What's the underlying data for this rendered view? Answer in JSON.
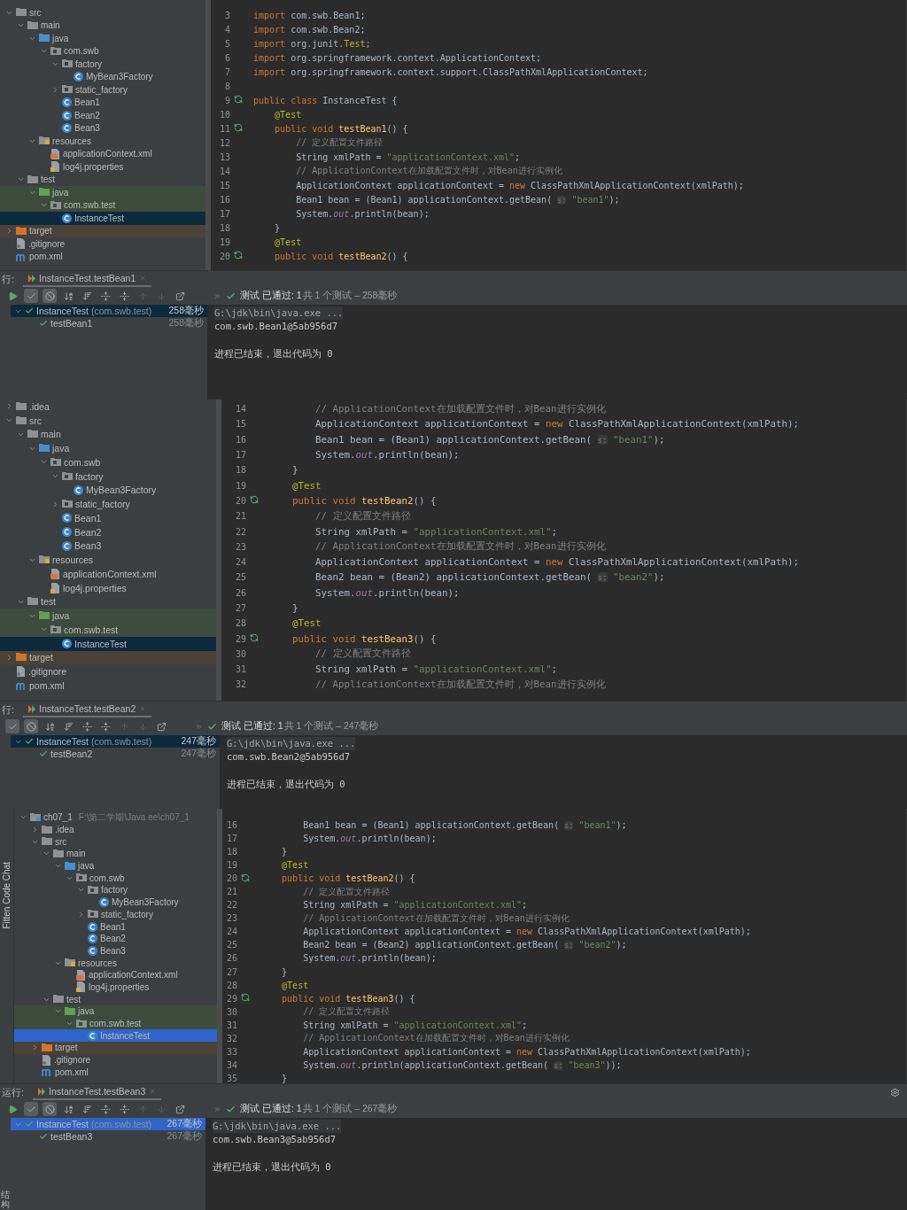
{
  "sections": [
    {
      "tree": [
        {
          "label": "src",
          "kind": "folder",
          "expanded": true,
          "selected": false,
          "children": [
            {
              "label": "main",
              "kind": "folder",
              "expanded": true,
              "selected": false,
              "children": [
                {
                  "label": "java",
                  "kind": "source",
                  "expanded": true,
                  "selected": false,
                  "children": [
                    {
                      "label": "com.swb",
                      "kind": "package",
                      "expanded": true,
                      "selected": false,
                      "children": [
                        {
                          "label": "factory",
                          "kind": "package",
                          "expanded": true,
                          "selected": false,
                          "children": [
                            {
                              "label": "MyBean3Factory",
                              "kind": "class",
                              "selected": false
                            }
                          ]
                        },
                        {
                          "label": "static_factory",
                          "kind": "package",
                          "expanded": false,
                          "selected": false
                        },
                        {
                          "label": "Bean1",
                          "kind": "class",
                          "selected": false
                        },
                        {
                          "label": "Bean2",
                          "kind": "class",
                          "selected": false
                        },
                        {
                          "label": "Bean3",
                          "kind": "class",
                          "selected": false
                        }
                      ]
                    }
                  ]
                },
                {
                  "label": "resources",
                  "kind": "resources",
                  "expanded": true,
                  "selected": false,
                  "children": [
                    {
                      "label": "applicationContext.xml",
                      "kind": "xml",
                      "selected": false
                    },
                    {
                      "label": "log4j.properties",
                      "kind": "properties",
                      "selected": false
                    }
                  ]
                }
              ]
            },
            {
              "label": "test",
              "kind": "folder",
              "expanded": true,
              "selected": false,
              "children": [
                {
                  "label": "java",
                  "kind": "test-source",
                  "expanded": true,
                  "selected": false,
                  "children": [
                    {
                      "label": "com.swb.test",
                      "kind": "test-package",
                      "expanded": true,
                      "selected": false,
                      "children": [
                        {
                          "label": "InstanceTest",
                          "kind": "class",
                          "selected": true
                        }
                      ]
                    }
                  ]
                }
              ]
            }
          ]
        },
        {
          "label": "target",
          "kind": "excluded",
          "expanded": false,
          "selected": false
        },
        {
          "label": ".gitignore",
          "kind": "git",
          "selected": false
        },
        {
          "label": "pom.xml",
          "kind": "maven",
          "selected": false
        }
      ],
      "code": [
        {
          "n": "3",
          "run": false,
          "segs": [
            {
              "kind": "kw",
              "text": "import"
            },
            {
              "kind": "plain",
              "text": " com.swb.Bean1;"
            }
          ]
        },
        {
          "n": "4",
          "run": false,
          "segs": [
            {
              "kind": "kw",
              "text": "import"
            },
            {
              "kind": "plain",
              "text": " com.swb.Bean2;"
            }
          ]
        },
        {
          "n": "5",
          "run": false,
          "segs": [
            {
              "kind": "kw",
              "text": "import"
            },
            {
              "kind": "plain",
              "text": " org.junit."
            },
            {
              "kind": "ann",
              "text": "Test"
            },
            {
              "kind": "plain",
              "text": ";"
            }
          ]
        },
        {
          "n": "6",
          "run": false,
          "segs": [
            {
              "kind": "kw",
              "text": "import"
            },
            {
              "kind": "plain",
              "text": " org.springframework.context.ApplicationContext;"
            }
          ]
        },
        {
          "n": "7",
          "run": false,
          "segs": [
            {
              "kind": "kw",
              "text": "import"
            },
            {
              "kind": "plain",
              "text": " org.springframework.context.support.ClassPathXmlApplicationContext;"
            }
          ]
        },
        {
          "n": "8",
          "run": false
        },
        {
          "n": "9",
          "run": true,
          "segs": [
            {
              "kind": "kw",
              "text": "public class"
            },
            {
              "kind": "plain",
              "text": " InstanceTest {"
            }
          ]
        },
        {
          "n": "10",
          "run": false,
          "segs": [
            {
              "kind": "ann",
              "text": "    @Test"
            }
          ]
        },
        {
          "n": "11",
          "run": true,
          "segs": [
            {
              "kind": "kw",
              "text": "    public void "
            },
            {
              "kind": "fn",
              "text": "testBean1"
            },
            {
              "kind": "plain",
              "text": "() {"
            }
          ]
        },
        {
          "n": "12",
          "run": false,
          "segs": [
            {
              "kind": "cmt",
              "text": "        // 定义配置文件路径"
            }
          ]
        },
        {
          "n": "13",
          "run": false,
          "segs": [
            {
              "kind": "plain",
              "text": "        String xmlPath = "
            },
            {
              "kind": "str",
              "text": "\"applicationContext.xml\""
            },
            {
              "kind": "plain",
              "text": ";"
            }
          ]
        },
        {
          "n": "14",
          "run": false,
          "segs": [
            {
              "kind": "cmt",
              "text": "        // ApplicationContext在加载配置文件时，对Bean进行实例化"
            }
          ]
        },
        {
          "n": "15",
          "run": false,
          "segs": [
            {
              "kind": "plain",
              "text": "        ApplicationContext applicationContext = "
            },
            {
              "kind": "kw",
              "text": "new"
            },
            {
              "kind": "plain",
              "text": " ClassPathXmlApplicationContext(xmlPath);"
            }
          ]
        },
        {
          "n": "16",
          "run": false,
          "segs": [
            {
              "kind": "plain",
              "text": "        Bean1 bean = (Bean1) applicationContext.getBean( "
            },
            {
              "kind": "hint",
              "text": "s:"
            },
            {
              "kind": "str",
              "text": " \"bean1\""
            },
            {
              "kind": "plain",
              "text": ");"
            }
          ]
        },
        {
          "n": "17",
          "run": false,
          "segs": [
            {
              "kind": "plain",
              "text": "        System."
            },
            {
              "kind": "field",
              "text": "out"
            },
            {
              "kind": "plain",
              "text": ".println(bean);"
            }
          ]
        },
        {
          "n": "18",
          "run": false,
          "segs": [
            {
              "kind": "plain",
              "text": "    }"
            }
          ]
        },
        {
          "n": "19",
          "run": false,
          "segs": [
            {
              "kind": "ann",
              "text": "    @Test"
            }
          ]
        },
        {
          "n": "20",
          "run": true,
          "segs": [
            {
              "kind": "kw",
              "text": "    public void "
            },
            {
              "kind": "fn",
              "text": "testBean2"
            },
            {
              "kind": "plain",
              "text": "() {"
            }
          ]
        }
      ],
      "run": {
        "label": "行:",
        "tab": "InstanceTest.testBean1",
        "toolbar": [
          {
            "kind": "run",
            "on": false,
            "disabled": false
          },
          {
            "kind": "passed",
            "on": true,
            "disabled": false
          },
          {
            "kind": "ignored",
            "on": true,
            "disabled": false
          },
          {
            "kind": "sort-alpha",
            "on": false,
            "disabled": false
          },
          {
            "kind": "sort-time",
            "on": false,
            "disabled": false
          },
          {
            "kind": "expand",
            "on": false,
            "disabled": false
          },
          {
            "kind": "collapse",
            "on": false,
            "disabled": false
          },
          {
            "kind": "up",
            "on": false,
            "disabled": true
          },
          {
            "kind": "down",
            "on": false,
            "disabled": true
          },
          {
            "kind": "export",
            "on": false,
            "disabled": false
          }
        ],
        "status": "测试 已通过: 1",
        "status_detail": "共 1 个测试 – 258毫秒",
        "tests": [
          {
            "name": "InstanceTest",
            "package": "(com.swb.test)",
            "time": "258毫秒",
            "selected": true,
            "children": [
              {
                "name": "testBean1",
                "time": "258毫秒",
                "selected": false
              }
            ]
          }
        ],
        "console": [
          {
            "kind": "command",
            "text": "G:\\jdk\\bin\\java.exe ..."
          },
          {
            "kind": "output",
            "text": "com.swb.Bean1@5ab956d7"
          },
          {
            "kind": "exit",
            "text": "进程已结束，退出代码为 0"
          }
        ]
      }
    },
    {
      "tree": [
        {
          "label": ".idea",
          "kind": "folder",
          "expanded": false,
          "selected": false
        },
        {
          "label": "src",
          "kind": "folder",
          "expanded": true,
          "selected": false,
          "children": [
            {
              "label": "main",
              "kind": "folder",
              "expanded": true,
              "selected": false,
              "children": [
                {
                  "label": "java",
                  "kind": "source",
                  "expanded": true,
                  "selected": false,
                  "children": [
                    {
                      "label": "com.swb",
                      "kind": "package",
                      "expanded": true,
                      "selected": false,
                      "children": [
                        {
                          "label": "factory",
                          "kind": "package",
                          "expanded": true,
                          "selected": false,
                          "children": [
                            {
                              "label": "MyBean3Factory",
                              "kind": "class",
                              "selected": false
                            }
                          ]
                        },
                        {
                          "label": "static_factory",
                          "kind": "package",
                          "expanded": false,
                          "selected": false
                        },
                        {
                          "label": "Bean1",
                          "kind": "class",
                          "selected": false
                        },
                        {
                          "label": "Bean2",
                          "kind": "class",
                          "selected": false
                        },
                        {
                          "label": "Bean3",
                          "kind": "class",
                          "selected": false
                        }
                      ]
                    }
                  ]
                },
                {
                  "label": "resources",
                  "kind": "resources",
                  "expanded": true,
                  "selected": false,
                  "children": [
                    {
                      "label": "applicationContext.xml",
                      "kind": "xml",
                      "selected": false
                    },
                    {
                      "label": "log4j.properties",
                      "kind": "properties",
                      "selected": false
                    }
                  ]
                }
              ]
            },
            {
              "label": "test",
              "kind": "folder",
              "expanded": true,
              "selected": false,
              "children": [
                {
                  "label": "java",
                  "kind": "test-source",
                  "expanded": true,
                  "selected": false,
                  "children": [
                    {
                      "label": "com.swb.test",
                      "kind": "test-package",
                      "expanded": true,
                      "selected": false,
                      "children": [
                        {
                          "label": "InstanceTest",
                          "kind": "class",
                          "selected": true
                        }
                      ]
                    }
                  ]
                }
              ]
            }
          ]
        },
        {
          "label": "target",
          "kind": "excluded",
          "expanded": false,
          "selected": false
        },
        {
          "label": ".gitignore",
          "kind": "git",
          "selected": false
        },
        {
          "label": "pom.xml",
          "kind": "maven",
          "selected": false
        }
      ],
      "code": [
        {
          "n": "14",
          "run": false,
          "segs": [
            {
              "kind": "cmt",
              "text": "        // ApplicationContext在加载配置文件时，对Bean进行实例化"
            }
          ]
        },
        {
          "n": "15",
          "run": false,
          "segs": [
            {
              "kind": "plain",
              "text": "        ApplicationContext applicationContext = "
            },
            {
              "kind": "kw",
              "text": "new"
            },
            {
              "kind": "plain",
              "text": " ClassPathXmlApplicationContext(xmlPath);"
            }
          ]
        },
        {
          "n": "16",
          "run": false,
          "segs": [
            {
              "kind": "plain",
              "text": "        Bean1 bean = (Bean1) applicationContext.getBean( "
            },
            {
              "kind": "hint",
              "text": "s:"
            },
            {
              "kind": "str",
              "text": " \"bean1\""
            },
            {
              "kind": "plain",
              "text": ");"
            }
          ]
        },
        {
          "n": "17",
          "run": false,
          "segs": [
            {
              "kind": "plain",
              "text": "        System."
            },
            {
              "kind": "field",
              "text": "out"
            },
            {
              "kind": "plain",
              "text": ".println(bean);"
            }
          ]
        },
        {
          "n": "18",
          "run": false,
          "segs": [
            {
              "kind": "plain",
              "text": "    }"
            }
          ]
        },
        {
          "n": "19",
          "run": false,
          "segs": [
            {
              "kind": "ann",
              "text": "    @Test"
            }
          ]
        },
        {
          "n": "20",
          "run": true,
          "segs": [
            {
              "kind": "kw",
              "text": "    public void "
            },
            {
              "kind": "fn",
              "text": "testBean2"
            },
            {
              "kind": "plain",
              "text": "() {"
            }
          ]
        },
        {
          "n": "21",
          "run": false,
          "segs": [
            {
              "kind": "cmt",
              "text": "        // 定义配置文件路径"
            }
          ]
        },
        {
          "n": "22",
          "run": false,
          "segs": [
            {
              "kind": "plain",
              "text": "        String xmlPath = "
            },
            {
              "kind": "str",
              "text": "\"applicationContext.xml\""
            },
            {
              "kind": "plain",
              "text": ";"
            }
          ]
        },
        {
          "n": "23",
          "run": false,
          "segs": [
            {
              "kind": "cmt",
              "text": "        // ApplicationContext在加载配置文件时，对Bean进行实例化"
            }
          ]
        },
        {
          "n": "24",
          "run": false,
          "segs": [
            {
              "kind": "plain",
              "text": "        ApplicationContext applicationContext = "
            },
            {
              "kind": "kw",
              "text": "new"
            },
            {
              "kind": "plain",
              "text": " ClassPathXmlApplicationContext(xmlPath);"
            }
          ]
        },
        {
          "n": "25",
          "run": false,
          "segs": [
            {
              "kind": "plain",
              "text": "        Bean2 bean = (Bean2) applicationContext.getBean( "
            },
            {
              "kind": "hint",
              "text": "s:"
            },
            {
              "kind": "str",
              "text": " \"bean2\""
            },
            {
              "kind": "plain",
              "text": ");"
            }
          ]
        },
        {
          "n": "26",
          "run": false,
          "segs": [
            {
              "kind": "plain",
              "text": "        System."
            },
            {
              "kind": "field",
              "text": "out"
            },
            {
              "kind": "plain",
              "text": ".println(bean);"
            }
          ]
        },
        {
          "n": "27",
          "run": false,
          "segs": [
            {
              "kind": "plain",
              "text": "    }"
            }
          ]
        },
        {
          "n": "28",
          "run": false,
          "segs": [
            {
              "kind": "ann",
              "text": "    @Test"
            }
          ]
        },
        {
          "n": "29",
          "run": true,
          "segs": [
            {
              "kind": "kw",
              "text": "    public void "
            },
            {
              "kind": "fn",
              "text": "testBean3"
            },
            {
              "kind": "plain",
              "text": "() {"
            }
          ]
        },
        {
          "n": "30",
          "run": false,
          "segs": [
            {
              "kind": "cmt",
              "text": "        // 定义配置文件路径"
            }
          ]
        },
        {
          "n": "31",
          "run": false,
          "segs": [
            {
              "kind": "plain",
              "text": "        String xmlPath = "
            },
            {
              "kind": "str",
              "text": "\"applicationContext.xml\""
            },
            {
              "kind": "plain",
              "text": ";"
            }
          ]
        },
        {
          "n": "32",
          "run": false,
          "segs": [
            {
              "kind": "cmt",
              "text": "        // ApplicationContext在加载配置文件时，对Bean进行实例化"
            }
          ]
        }
      ],
      "run": {
        "label": "行:",
        "tab": "InstanceTest.testBean2",
        "toolbar": [
          {
            "kind": "passed",
            "on": true,
            "disabled": false
          },
          {
            "kind": "ignored",
            "on": true,
            "disabled": false
          },
          {
            "kind": "sort-alpha",
            "on": false,
            "disabled": false
          },
          {
            "kind": "sort-time",
            "on": false,
            "disabled": false
          },
          {
            "kind": "expand",
            "on": false,
            "disabled": false
          },
          {
            "kind": "collapse",
            "on": false,
            "disabled": false
          },
          {
            "kind": "up",
            "on": false,
            "disabled": true
          },
          {
            "kind": "down",
            "on": false,
            "disabled": true
          },
          {
            "kind": "export",
            "on": false,
            "disabled": false
          }
        ],
        "status": "测试 已通过: 1",
        "status_detail": "共 1 个测试 – 247毫秒",
        "tests": [
          {
            "name": "InstanceTest",
            "package": "(com.swb.test)",
            "time": "247毫秒",
            "selected": true,
            "children": [
              {
                "name": "testBean2",
                "time": "247毫秒",
                "selected": false
              }
            ]
          }
        ],
        "console": [
          {
            "kind": "command",
            "text": "G:\\jdk\\bin\\java.exe ..."
          },
          {
            "kind": "output",
            "text": "com.swb.Bean2@5ab956d7"
          },
          {
            "kind": "exit",
            "text": "进程已结束，退出代码为 0"
          }
        ]
      }
    },
    {
      "side_label": "Fitten Code Chat",
      "tree": [
        {
          "label": "ch07_1",
          "hint": "F:\\第二学期\\Java ee\\ch07_1",
          "kind": "module",
          "expanded": true,
          "selected": false,
          "children": [
            {
              "label": ".idea",
              "kind": "folder",
              "expanded": false,
              "selected": false
            },
            {
              "label": "src",
              "kind": "folder",
              "expanded": true,
              "selected": false,
              "children": [
                {
                  "label": "main",
                  "kind": "folder",
                  "expanded": true,
                  "selected": false,
                  "children": [
                    {
                      "label": "java",
                      "kind": "source",
                      "expanded": true,
                      "selected": false,
                      "children": [
                        {
                          "label": "com.swb",
                          "kind": "package",
                          "expanded": true,
                          "selected": false,
                          "children": [
                            {
                              "label": "factory",
                              "kind": "package",
                              "expanded": true,
                              "selected": false,
                              "children": [
                                {
                                  "label": "MyBean3Factory",
                                  "kind": "class",
                                  "selected": false
                                }
                              ]
                            },
                            {
                              "label": "static_factory",
                              "kind": "package",
                              "expanded": false,
                              "selected": false
                            },
                            {
                              "label": "Bean1",
                              "kind": "class",
                              "selected": false
                            },
                            {
                              "label": "Bean2",
                              "kind": "class",
                              "selected": false
                            },
                            {
                              "label": "Bean3",
                              "kind": "class",
                              "selected": false
                            }
                          ]
                        }
                      ]
                    },
                    {
                      "label": "resources",
                      "kind": "resources",
                      "expanded": true,
                      "selected": false,
                      "children": [
                        {
                          "label": "applicationContext.xml",
                          "kind": "xml",
                          "selected": false
                        },
                        {
                          "label": "log4j.properties",
                          "kind": "properties",
                          "selected": false
                        }
                      ]
                    }
                  ]
                },
                {
                  "label": "test",
                  "kind": "folder",
                  "expanded": true,
                  "selected": false,
                  "children": [
                    {
                      "label": "java",
                      "kind": "test-source",
                      "expanded": true,
                      "selected": false,
                      "children": [
                        {
                          "label": "com.swb.test",
                          "kind": "test-package",
                          "expanded": true,
                          "selected": false,
                          "children": [
                            {
                              "label": "InstanceTest",
                              "kind": "class",
                              "selected": true
                            }
                          ]
                        }
                      ]
                    }
                  ]
                }
              ]
            },
            {
              "label": "target",
              "kind": "excluded",
              "expanded": false,
              "selected": false
            },
            {
              "label": ".gitignore",
              "kind": "git",
              "selected": false
            },
            {
              "label": "pom.xml",
              "kind": "maven",
              "selected": false
            }
          ]
        }
      ],
      "code": [
        {
          "n": "16",
          "run": false,
          "segs": [
            {
              "kind": "plain",
              "text": "        Bean1 bean = (Bean1) applicationContext.getBean( "
            },
            {
              "kind": "hint",
              "text": "s:"
            },
            {
              "kind": "str",
              "text": " \"bean1\""
            },
            {
              "kind": "plain",
              "text": ");"
            }
          ]
        },
        {
          "n": "17",
          "run": false,
          "segs": [
            {
              "kind": "plain",
              "text": "        System."
            },
            {
              "kind": "field",
              "text": "out"
            },
            {
              "kind": "plain",
              "text": ".println(bean);"
            }
          ]
        },
        {
          "n": "18",
          "run": false,
          "segs": [
            {
              "kind": "plain",
              "text": "    }"
            }
          ]
        },
        {
          "n": "19",
          "run": false,
          "segs": [
            {
              "kind": "ann",
              "text": "    @Test"
            }
          ]
        },
        {
          "n": "20",
          "run": true,
          "segs": [
            {
              "kind": "kw",
              "text": "    public void "
            },
            {
              "kind": "fn",
              "text": "testBean2"
            },
            {
              "kind": "plain",
              "text": "() {"
            }
          ]
        },
        {
          "n": "21",
          "run": false,
          "segs": [
            {
              "kind": "cmt",
              "text": "        // 定义配置文件路径"
            }
          ]
        },
        {
          "n": "22",
          "run": false,
          "segs": [
            {
              "kind": "plain",
              "text": "        String xmlPath = "
            },
            {
              "kind": "str",
              "text": "\"applicationContext.xml\""
            },
            {
              "kind": "plain",
              "text": ";"
            }
          ]
        },
        {
          "n": "23",
          "run": false,
          "segs": [
            {
              "kind": "cmt",
              "text": "        // ApplicationContext在加载配置文件时，对Bean进行实例化"
            }
          ]
        },
        {
          "n": "24",
          "run": false,
          "segs": [
            {
              "kind": "plain",
              "text": "        ApplicationContext applicationContext = "
            },
            {
              "kind": "kw",
              "text": "new"
            },
            {
              "kind": "plain",
              "text": " ClassPathXmlApplicationContext(xmlPath);"
            }
          ]
        },
        {
          "n": "25",
          "run": false,
          "segs": [
            {
              "kind": "plain",
              "text": "        Bean2 bean = (Bean2) applicationContext.getBean( "
            },
            {
              "kind": "hint",
              "text": "s:"
            },
            {
              "kind": "str",
              "text": " \"bean2\""
            },
            {
              "kind": "plain",
              "text": ");"
            }
          ]
        },
        {
          "n": "26",
          "run": false,
          "segs": [
            {
              "kind": "plain",
              "text": "        System."
            },
            {
              "kind": "field",
              "text": "out"
            },
            {
              "kind": "plain",
              "text": ".println(bean);"
            }
          ]
        },
        {
          "n": "27",
          "run": false,
          "segs": [
            {
              "kind": "plain",
              "text": "    }"
            }
          ]
        },
        {
          "n": "28",
          "run": false,
          "segs": [
            {
              "kind": "ann",
              "text": "    @Test"
            }
          ]
        },
        {
          "n": "29",
          "run": true,
          "segs": [
            {
              "kind": "kw",
              "text": "    public void "
            },
            {
              "kind": "fn",
              "text": "testBean3"
            },
            {
              "kind": "plain",
              "text": "() {"
            }
          ]
        },
        {
          "n": "30",
          "run": false,
          "segs": [
            {
              "kind": "cmt",
              "text": "        // 定义配置文件路径"
            }
          ]
        },
        {
          "n": "31",
          "run": false,
          "segs": [
            {
              "kind": "plain",
              "text": "        String xmlPath = "
            },
            {
              "kind": "str",
              "text": "\"applicationContext.xml\""
            },
            {
              "kind": "plain",
              "text": ";"
            }
          ]
        },
        {
          "n": "32",
          "run": false,
          "segs": [
            {
              "kind": "cmt",
              "text": "        // ApplicationContext在加载配置文件时，对Bean进行实例化"
            }
          ]
        },
        {
          "n": "33",
          "run": false,
          "segs": [
            {
              "kind": "plain",
              "text": "        ApplicationContext applicationContext = "
            },
            {
              "kind": "kw",
              "text": "new"
            },
            {
              "kind": "plain",
              "text": " ClassPathXmlApplicationContext(xmlPath);"
            }
          ]
        },
        {
          "n": "34",
          "run": false,
          "segs": [
            {
              "kind": "plain",
              "text": "        System."
            },
            {
              "kind": "field",
              "text": "out"
            },
            {
              "kind": "plain",
              "text": ".println(applicationContext.getBean( "
            },
            {
              "kind": "hint",
              "text": "s:"
            },
            {
              "kind": "str",
              "text": " \"bean3\""
            },
            {
              "kind": "plain",
              "text": "));"
            }
          ]
        },
        {
          "n": "35",
          "run": false,
          "segs": [
            {
              "kind": "plain",
              "text": "    }"
            }
          ]
        }
      ],
      "run": {
        "label": "运行:",
        "tab": "InstanceTest.testBean3",
        "settings_button": true,
        "side_label": "结构",
        "toolbar": [
          {
            "kind": "run",
            "on": false,
            "disabled": false
          },
          {
            "kind": "passed",
            "on": true,
            "disabled": false
          },
          {
            "kind": "ignored",
            "on": true,
            "disabled": false
          },
          {
            "kind": "sort-alpha",
            "on": false,
            "disabled": false
          },
          {
            "kind": "sort-time",
            "on": false,
            "disabled": false
          },
          {
            "kind": "expand",
            "on": false,
            "disabled": false
          },
          {
            "kind": "collapse",
            "on": false,
            "disabled": false
          },
          {
            "kind": "up",
            "on": false,
            "disabled": true
          },
          {
            "kind": "down",
            "on": false,
            "disabled": true
          },
          {
            "kind": "export",
            "on": false,
            "disabled": false
          }
        ],
        "status": "测试 已通过: 1",
        "status_detail": "共 1 个测试 – 267毫秒",
        "tests": [
          {
            "name": "InstanceTest",
            "package": "(com.swb.test)",
            "time": "267毫秒",
            "selected": true,
            "children": [
              {
                "name": "testBean3",
                "time": "267毫秒",
                "selected": false
              }
            ]
          }
        ],
        "console": [
          {
            "kind": "command",
            "text": "G:\\jdk\\bin\\java.exe ..."
          },
          {
            "kind": "output",
            "text": "com.swb.Bean3@5ab956d7"
          },
          {
            "kind": "exit",
            "text": "进程已结束，退出代码为 0"
          }
        ]
      }
    }
  ]
}
